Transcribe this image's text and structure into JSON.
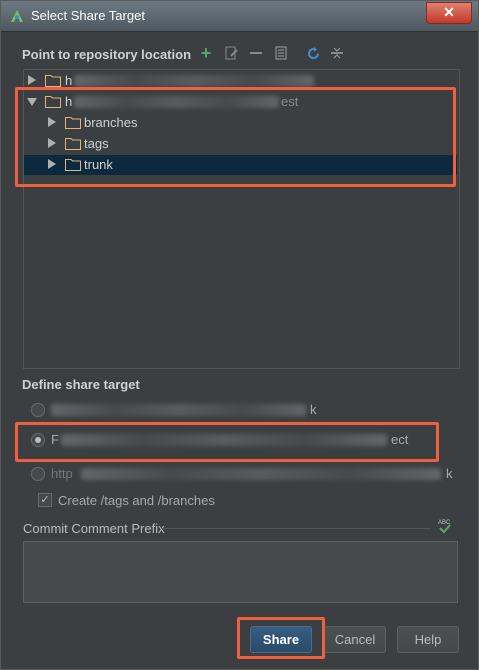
{
  "window": {
    "title": "Select Share Target",
    "close_label": "✕"
  },
  "repo": {
    "label": "Point to repository location",
    "toolbar_icons": [
      "add-icon",
      "edit-icon",
      "remove-icon",
      "details-icon",
      "refresh-icon",
      "collapse-all-icon"
    ],
    "tree": [
      {
        "label": "h",
        "expanded": false,
        "blurred": true
      },
      {
        "label": "h",
        "tail": "est",
        "expanded": true,
        "blurred": true
      },
      {
        "label": "branches",
        "expanded": false
      },
      {
        "label": "tags",
        "expanded": false
      },
      {
        "label": "trunk",
        "expanded": false,
        "selected": true
      }
    ]
  },
  "share_target": {
    "label": "Define share target",
    "options": [
      {
        "tail": "k",
        "checked": false
      },
      {
        "text_start": "F",
        "tail": "ect",
        "checked": true
      },
      {
        "text_start": "http",
        "tail": "k",
        "checked": false
      }
    ],
    "create_tags_label": "Create /tags and /branches",
    "create_tags_checked": true
  },
  "commit": {
    "label": "Commit Comment Prefix",
    "value": ""
  },
  "buttons": {
    "share": "Share",
    "cancel": "Cancel",
    "help": "Help"
  },
  "colors": {
    "background": "#3c3f41",
    "selection": "#0d293e",
    "highlight_box": "#f06040",
    "add_icon": "#59a869",
    "refresh_icon": "#3a8fd9"
  }
}
